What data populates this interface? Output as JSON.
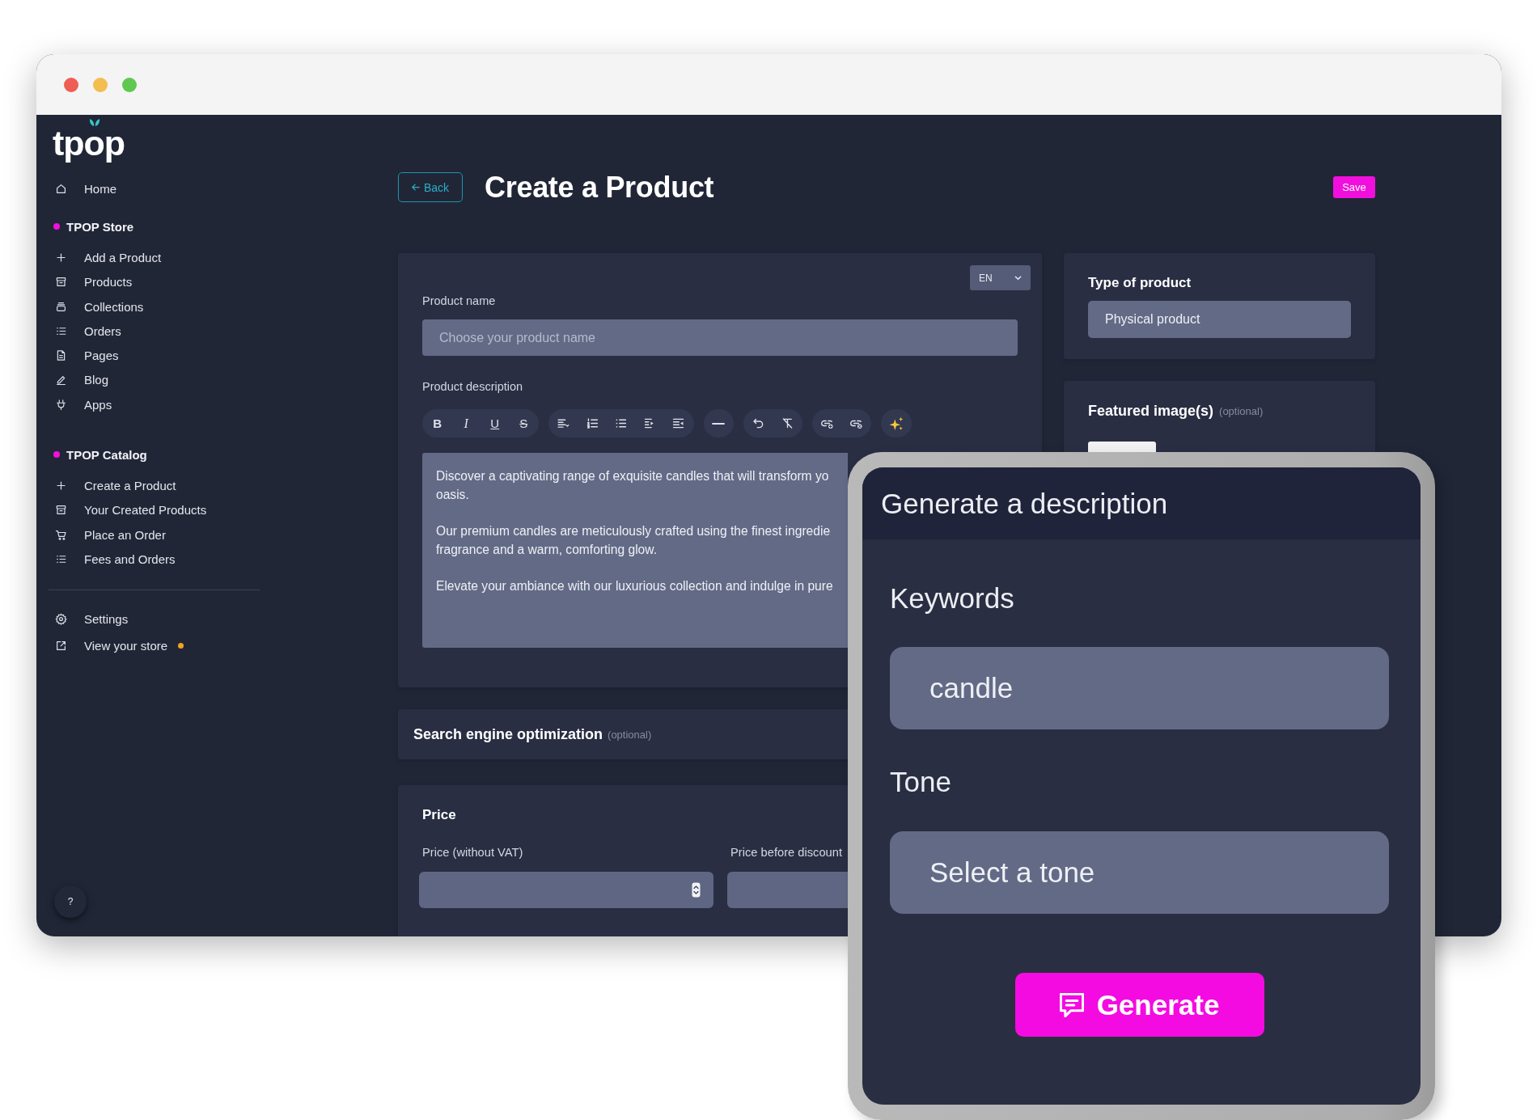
{
  "sidebar": {
    "logo": "tpop",
    "home": "Home",
    "sections": [
      {
        "title": "TPOP Store",
        "items": [
          "Add a Product",
          "Products",
          "Collections",
          "Orders",
          "Pages",
          "Blog",
          "Apps"
        ]
      },
      {
        "title": "TPOP Catalog",
        "items": [
          "Create a Product",
          "Your Created Products",
          "Place an Order",
          "Fees and Orders"
        ]
      }
    ],
    "footer_items": [
      {
        "label": "Settings",
        "badge_dot": false
      },
      {
        "label": "View your store",
        "badge_dot": true
      }
    ],
    "help_button": "?"
  },
  "header": {
    "back_button": "Back",
    "title": "Create a Product",
    "save_button": "Save"
  },
  "product_form": {
    "language": "EN",
    "product_name": {
      "label": "Product name",
      "placeholder": "Choose your product name"
    },
    "description": {
      "label": "Product description",
      "format_buttons": [
        "B",
        "I",
        "U",
        "S"
      ],
      "paragraphs": [
        [
          "Discover a captivating range of exquisite candles that will transform yo",
          "oasis."
        ],
        [
          "Our premium candles are meticulously crafted using the finest ingredie",
          "fragrance and a warm, comforting glow."
        ],
        [
          "Elevate your ambiance with our luxurious collection and indulge in pure"
        ]
      ]
    }
  },
  "seo": {
    "title": "Search engine optimization",
    "note": "(optional)"
  },
  "price": {
    "title": "Price",
    "fields": [
      {
        "label": "Price (without VAT)",
        "spinner": true
      },
      {
        "label": "Price before discount",
        "spinner": false
      }
    ]
  },
  "type_of_product": {
    "title": "Type of product",
    "value": "Physical product"
  },
  "featured_images": {
    "title": "Featured image(s)",
    "note": "(optional)"
  },
  "generate_dialog": {
    "title": "Generate a description",
    "keywords": {
      "label": "Keywords",
      "value": "candle"
    },
    "tone": {
      "label": "Tone",
      "value": "Select a tone"
    },
    "generate_button": "Generate"
  }
}
